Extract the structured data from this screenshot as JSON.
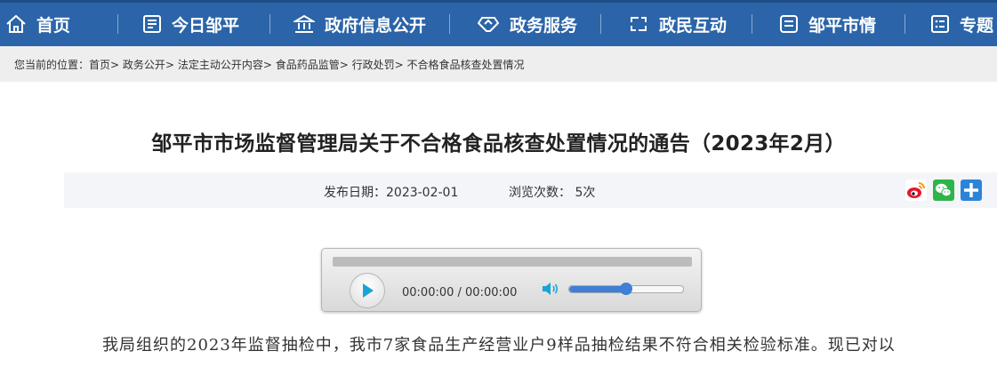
{
  "nav": {
    "items": [
      {
        "label": "首页",
        "icon": "home-icon"
      },
      {
        "label": "今日邹平",
        "icon": "news-icon"
      },
      {
        "label": "政府信息公开",
        "icon": "government-building-icon"
      },
      {
        "label": "政务服务",
        "icon": "handshake-icon"
      },
      {
        "label": "政民互动",
        "icon": "interaction-icon"
      },
      {
        "label": "邹平市情",
        "icon": "city-info-icon"
      },
      {
        "label": "专题",
        "icon": "topic-list-icon"
      }
    ],
    "background": "#2b64a8"
  },
  "breadcrumb": {
    "prefix": "您当前的位置：",
    "items": [
      "首页",
      "政务公开",
      "法定主动公开内容",
      "食品药品监管",
      "行政处罚",
      "不合格食品核查处置情况"
    ],
    "separator": ">"
  },
  "article": {
    "title": "邹平市市场监督管理局关于不合格食品核查处置情况的通告（2023年2月）",
    "publish_label": "发布日期：",
    "publish_date": "2023-02-01",
    "views_label": "浏览次数：",
    "views_count": "5次",
    "share_icons": [
      "weibo-icon",
      "wechat-icon",
      "more-share-icon"
    ],
    "body_first_line": "我局组织的2023年监督抽检中，我市7家食品生产经营业户9样品抽检结果不符合相关检验标准。现已对以"
  },
  "player": {
    "time": "00:00:00 / 00:00:00",
    "progress": 0,
    "volume": 0.5
  }
}
